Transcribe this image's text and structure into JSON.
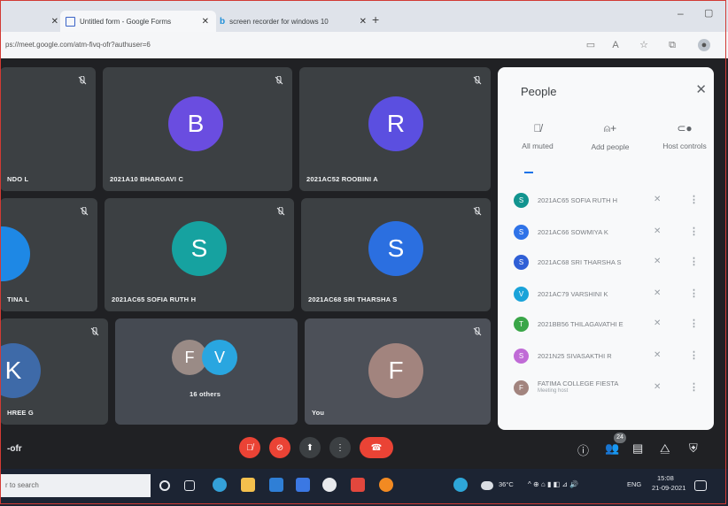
{
  "browser": {
    "tabs": [
      {
        "label": ""
      },
      {
        "label": "Untitled form - Google Forms"
      },
      {
        "label": "screen recorder for windows 10"
      }
    ],
    "url": "ps://meet.google.com/atm-fivq-ofr?authuser=6"
  },
  "tiles": [
    {
      "name": "NDO L",
      "avatar_letter": "",
      "avatar_color": "#8ab4f8"
    },
    {
      "name": "2021A10 BHARGAVI C",
      "avatar_letter": "B",
      "avatar_color": "#6a4de0"
    },
    {
      "name": "2021AC52 ROOBINI A",
      "avatar_letter": "R",
      "avatar_color": "#5b4fe0"
    },
    {
      "name": "TINA L",
      "avatar_letter": "",
      "avatar_color": "#1e88e5"
    },
    {
      "name": "2021AC65 SOFIA RUTH H",
      "avatar_letter": "S",
      "avatar_color": "#16a2a0"
    },
    {
      "name": "2021AC68 SRI THARSHA S",
      "avatar_letter": "S",
      "avatar_color": "#2b6fe0"
    },
    {
      "name": "HREE G",
      "avatar_letter": "K",
      "avatar_color": "#3e6aa8"
    },
    {
      "name": "16 others",
      "avatar_letter": "F",
      "avatar_letter_2": "V",
      "avatar_color": "#9a8b86",
      "avatar_color_2": "#29a6e0"
    },
    {
      "name": "You",
      "avatar_letter": "F",
      "avatar_color": "#a2847e"
    }
  ],
  "people_panel": {
    "title": "People",
    "tabs": [
      {
        "label": "All muted",
        "icon": "mic-off-icon"
      },
      {
        "label": "Add people",
        "icon": "add-person-icon"
      },
      {
        "label": "Host controls",
        "icon": "toggle-icon"
      }
    ],
    "participants": [
      {
        "initial": "S",
        "name": "2021AC65 SOFIA RUTH H",
        "color": "#12948f"
      },
      {
        "initial": "S",
        "name": "2021AC66 SOWMIYA K",
        "color": "#2f73e8"
      },
      {
        "initial": "S",
        "name": "2021AC68 SRI THARSHA S",
        "color": "#2f5fd6"
      },
      {
        "initial": "V",
        "name": "2021AC79 VARSHINI K",
        "color": "#1aa3d9"
      },
      {
        "initial": "T",
        "name": "2021BB56 THILAGAVATHI E",
        "color": "#3aa648"
      },
      {
        "initial": "S",
        "name": "2021N25 SIVASAKTHI R",
        "color": "#c06bd6"
      },
      {
        "initial": "F",
        "name": "FATIMA COLLEGE FIESTA",
        "sub": "Meeting host",
        "color": "#a2847e"
      }
    ]
  },
  "bottom_bar": {
    "meeting_code": "-ofr",
    "participant_count": "24"
  },
  "taskbar": {
    "search_placeholder": "r to search",
    "temperature": "36°C",
    "language": "ENG",
    "time": "15:08",
    "date": "21-09-2021"
  }
}
